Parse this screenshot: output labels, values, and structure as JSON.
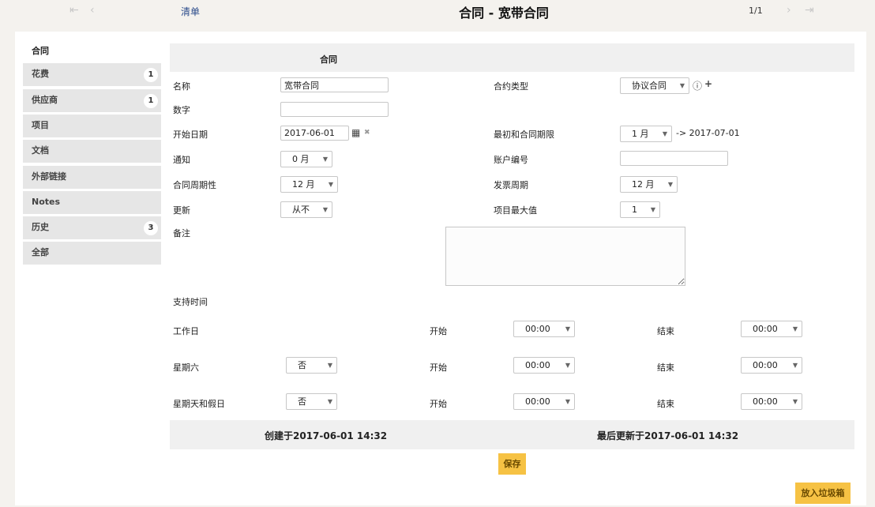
{
  "nav": {
    "first_icon": "⇤",
    "prev_icon": "‹",
    "next_icon": "›",
    "last_icon": "⇥",
    "list_label": "清单",
    "title": "合同 - 宽带合同",
    "pager": "1/1"
  },
  "sidebar": {
    "header": "合同",
    "items": [
      {
        "label": "花费",
        "badge": "1"
      },
      {
        "label": "供应商",
        "badge": "1"
      },
      {
        "label": "项目",
        "badge": ""
      },
      {
        "label": "文档",
        "badge": ""
      },
      {
        "label": "外部链接",
        "badge": ""
      },
      {
        "label": "Notes",
        "badge": ""
      },
      {
        "label": "历史",
        "badge": "3"
      },
      {
        "label": "全部",
        "badge": ""
      }
    ]
  },
  "form": {
    "section_title": "合同",
    "name_label": "名称",
    "name_value": "宽带合同",
    "number_label": "数字",
    "number_value": "",
    "start_date_label": "开始日期",
    "start_date_value": "2017-06-01",
    "notice_label": "通知",
    "notice_value": "0 月",
    "periodicity_label": "合同周期性",
    "periodicity_value": "12 月",
    "renewal_label": "更新",
    "renewal_value": "从不",
    "comment_label": "备注",
    "type_label": "合约类型",
    "type_value": "协议合同",
    "initial_period_label": "最初和合同期限",
    "initial_period_value": "1 月",
    "end_date_text": "-> 2017-07-01",
    "account_label": "账户编号",
    "account_value": "",
    "billing_label": "发票周期",
    "billing_value": "12 月",
    "max_items_label": "项目最大值",
    "max_items_value": "1",
    "support_label": "支持时间",
    "workday_label": "工作日",
    "saturday_label": "星期六",
    "saturday_value": "否",
    "sunday_label": "星期天和假日",
    "sunday_value": "否",
    "start_label": "开始",
    "end_label": "结束",
    "time_value": "00:00",
    "info_icon": "ⓘ",
    "plus_icon": "+",
    "calendar_icon": "▦",
    "clear_icon": "✖"
  },
  "footer": {
    "created": "创建于2017-06-01 14:32",
    "updated": "最后更新于2017-06-01 14:32",
    "save_label": "保存",
    "trash_label": "放入垃圾箱"
  }
}
